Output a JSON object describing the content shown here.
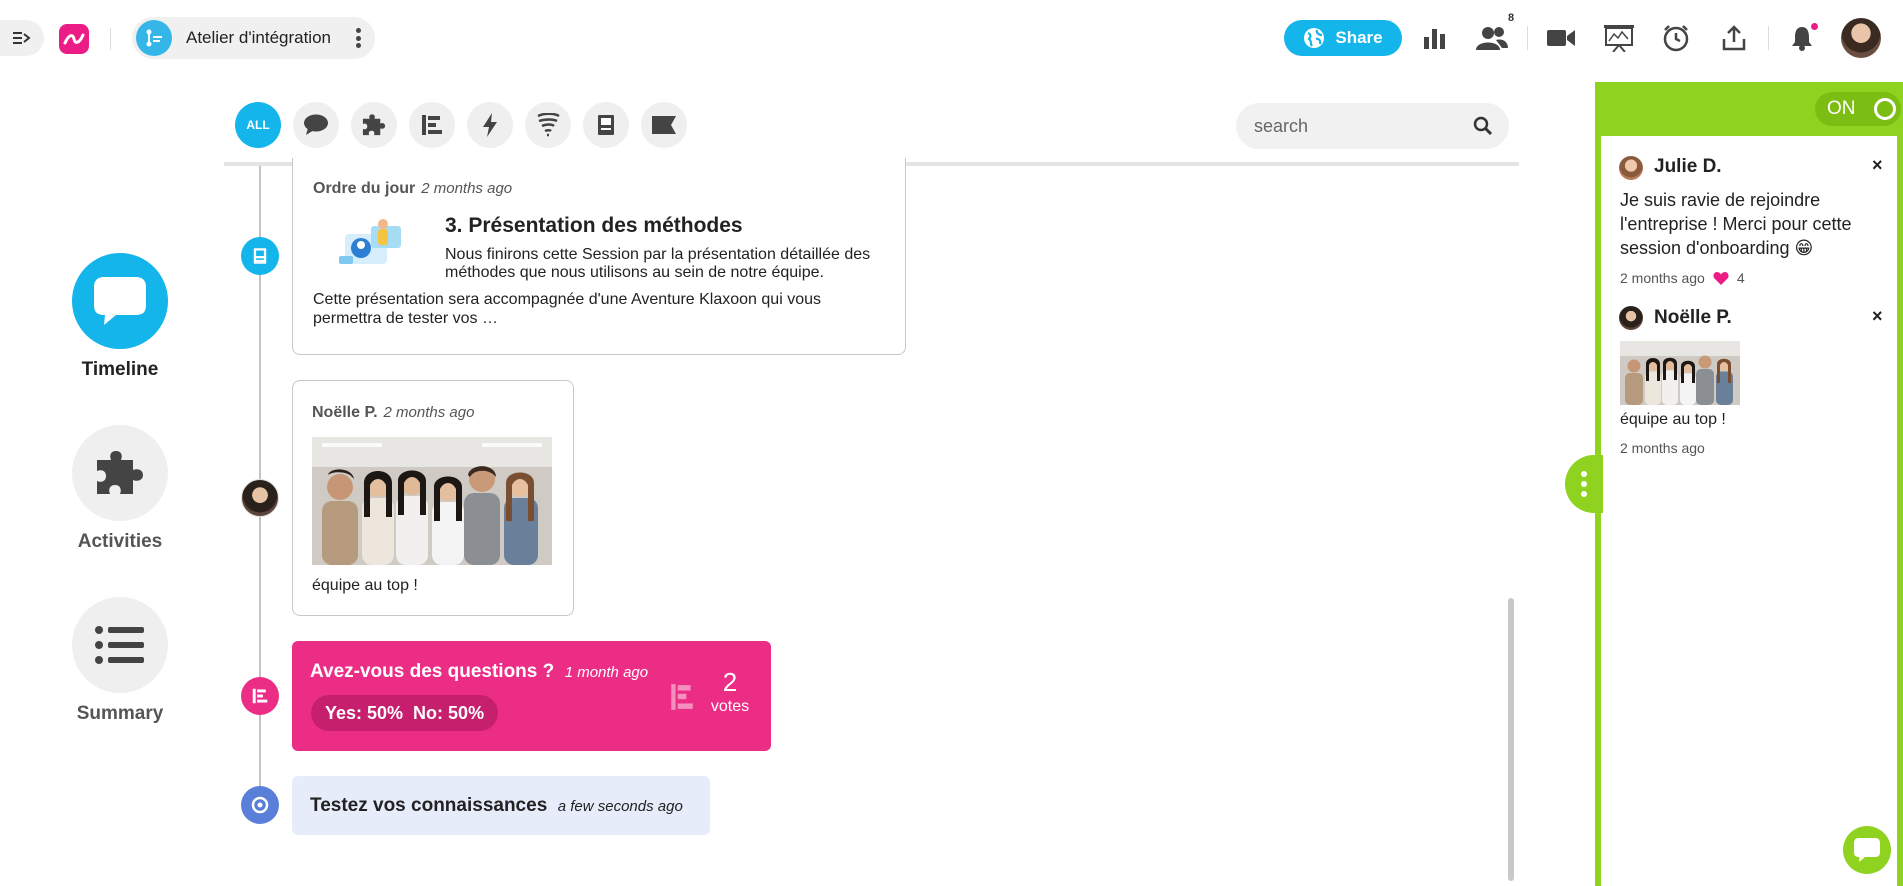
{
  "header": {
    "session_title": "Atelier d'intégration",
    "share_label": "Share",
    "participants_count": "8"
  },
  "nav": {
    "items": [
      {
        "label": "Timeline",
        "icon": "speech-bubble-icon",
        "active": true
      },
      {
        "label": "Activities",
        "icon": "puzzle-icon",
        "active": false
      },
      {
        "label": "Summary",
        "icon": "list-icon",
        "active": false
      }
    ]
  },
  "filters": {
    "all_label": "ALL",
    "search_placeholder": "search"
  },
  "timeline": {
    "agenda": {
      "author": "Ordre du jour",
      "time": "2 months ago",
      "title": "3. Présentation des méthodes",
      "lead": "Nous finirons cette Session par la présentation détaillée des méthodes que nous utilisons au sein de notre équipe.",
      "body": "Cette présentation sera accompagnée d'une Aventure Klaxoon qui vous permettra de tester vos …"
    },
    "photo_post": {
      "author": "Noëlle P.",
      "time": "2 months ago",
      "caption": "équipe au top !"
    },
    "question": {
      "title": "Avez-vous des questions ?",
      "time": "1 month ago",
      "result": "Yes: 50%  No: 50%",
      "votes_count": "2",
      "votes_label": "votes"
    },
    "quiz": {
      "title": "Testez vos connaissances",
      "time": "a few seconds ago"
    }
  },
  "panel": {
    "toggle_label": "ON",
    "posts": [
      {
        "author": "Julie D.",
        "text": "Je suis ravie de rejoindre l'entreprise ! Merci pour cette session d'onboarding 😁",
        "time": "2 months ago",
        "likes": "4"
      },
      {
        "author": "Noëlle P.",
        "caption": "équipe au top !",
        "time": "2 months ago"
      }
    ]
  },
  "colors": {
    "primary_blue": "#13b5ea",
    "brand_pink": "#ec1c86",
    "panel_green": "#8fd320",
    "quiz_bg": "#e6ecfa"
  }
}
